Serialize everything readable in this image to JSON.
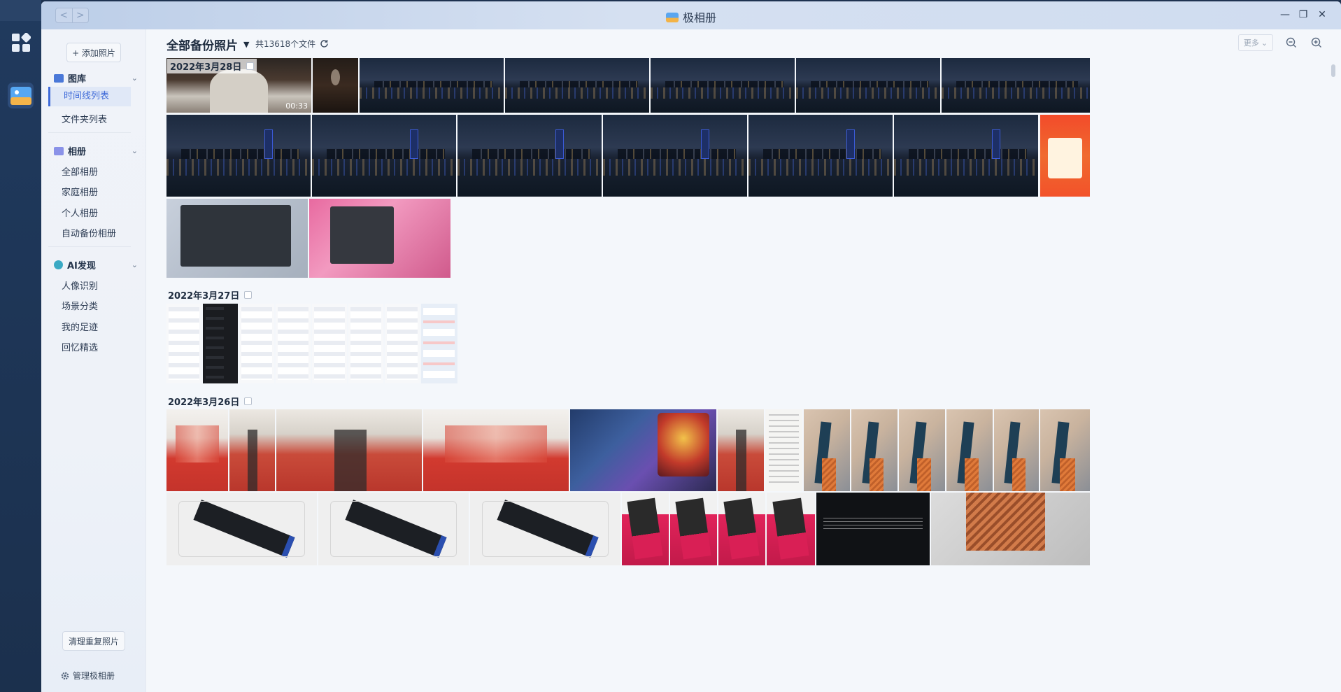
{
  "window": {
    "title": "极相册",
    "nav_back": "<",
    "nav_forward": ">",
    "minimize": "—",
    "maximize": "❐",
    "close": "✕"
  },
  "sidebar": {
    "add_button": "+ 添加照片",
    "library": {
      "label": "图库",
      "items": [
        "时间线列表",
        "文件夹列表"
      ]
    },
    "albums": {
      "label": "相册",
      "items": [
        "全部相册",
        "家庭相册",
        "个人相册",
        "自动备份相册"
      ]
    },
    "ai": {
      "label": "AI发现",
      "items": [
        "人像识别",
        "场景分类",
        "我的足迹",
        "回忆精选"
      ]
    },
    "dedupe_button": "清理重复照片",
    "manage": "管理极相册"
  },
  "header": {
    "title": "全部备份照片",
    "file_count": "共13618个文件",
    "more": "更多"
  },
  "groups": [
    {
      "date": "2022年3月28日",
      "video_duration": "00:33"
    },
    {
      "date": "2022年3月27日"
    },
    {
      "date": "2022年3月26日"
    }
  ],
  "colors": {
    "accent": "#3e6ad8",
    "titlebar": "#c9d8ee",
    "rail": "#1e3250"
  },
  "icons": {
    "refresh": "refresh-icon",
    "zoom_out": "zoom-out-icon",
    "zoom_in": "zoom-in-icon",
    "settings": "gear-icon"
  }
}
